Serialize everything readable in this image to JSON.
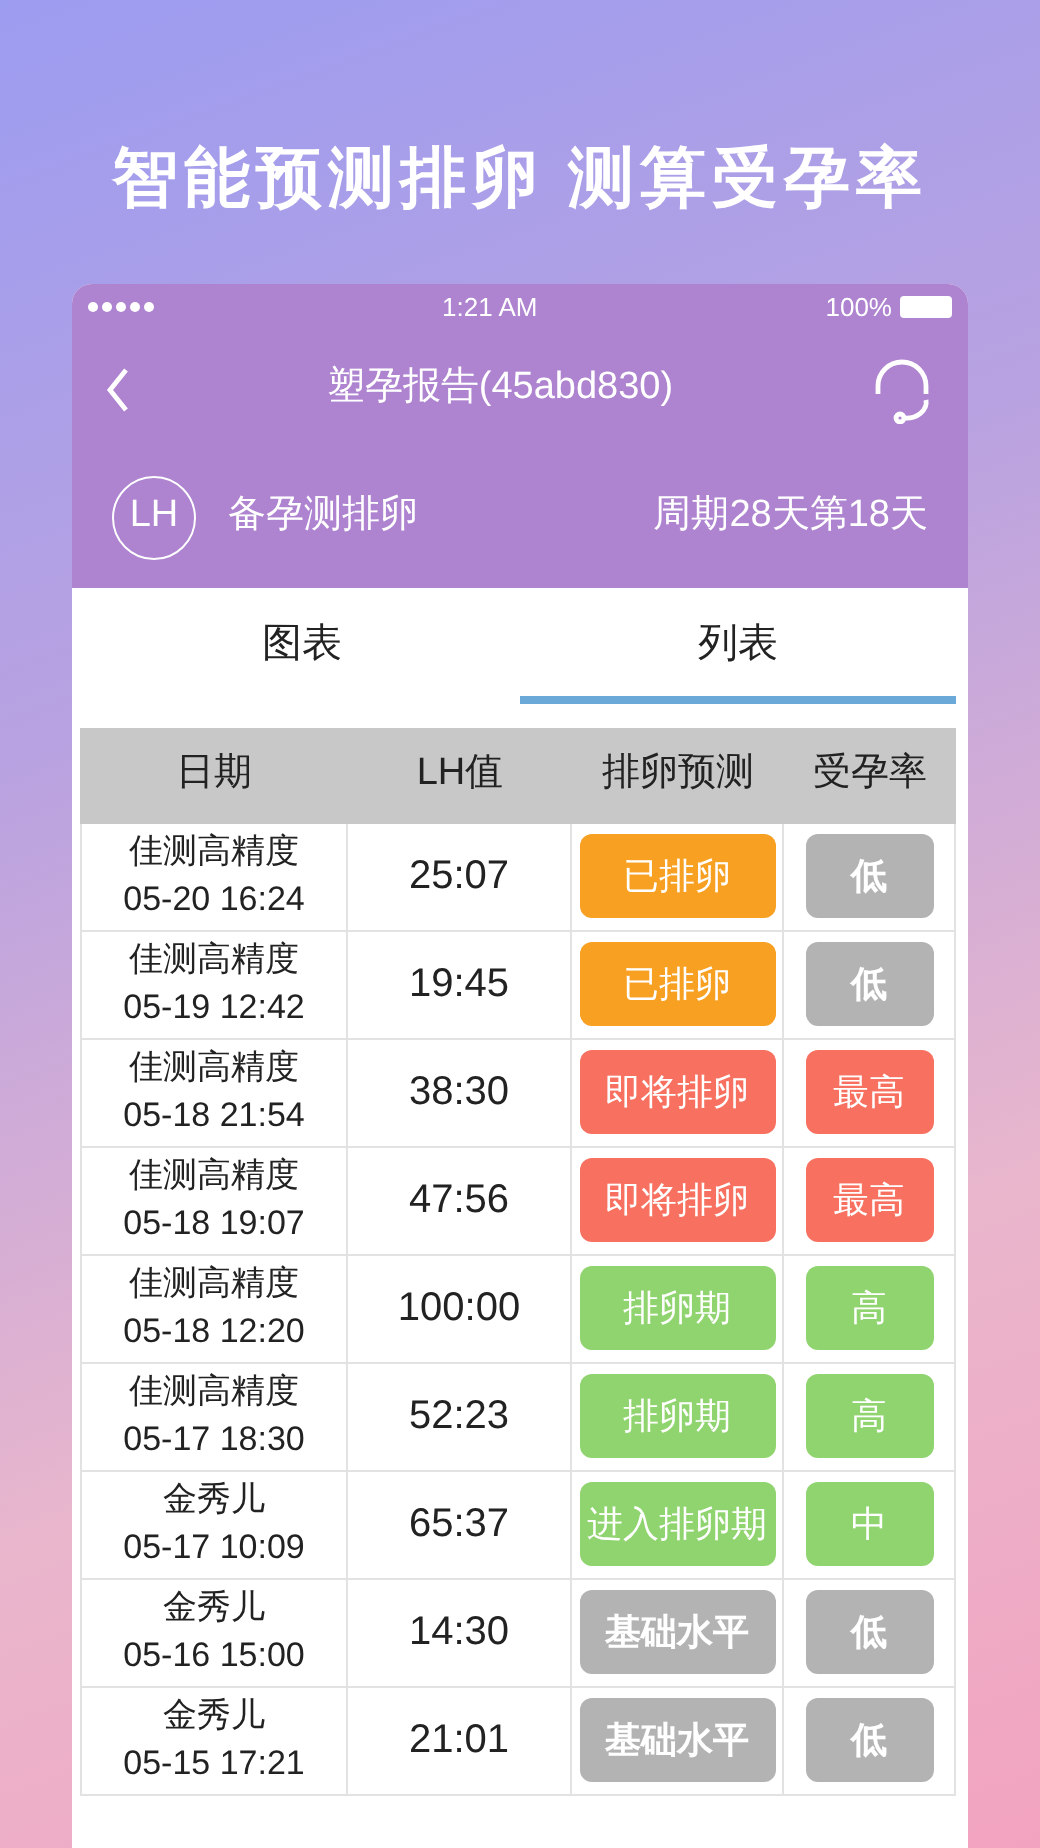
{
  "headline": "智能预测排卵 测算受孕率",
  "status_bar": {
    "time": "1:21 AM",
    "battery": "100%"
  },
  "nav": {
    "title": "塑孕报告(45abd830)"
  },
  "info": {
    "badge": "LH",
    "label": "备孕测排卵",
    "cycle": "周期28天第18天"
  },
  "tabs": [
    {
      "label": "图表",
      "selected": false
    },
    {
      "label": "列表",
      "selected": true
    }
  ],
  "table": {
    "columns": [
      "日期",
      "LH值",
      "排卵预测",
      "受孕率"
    ],
    "rows": [
      {
        "source": "佳测高精度",
        "date": "05-20 16:24",
        "lh": "25:07",
        "prediction": {
          "text": "已排卵",
          "color": "#f7a021"
        },
        "rate": {
          "text": "低",
          "color": "#b3b3b3"
        }
      },
      {
        "source": "佳测高精度",
        "date": "05-19 12:42",
        "lh": "19:45",
        "prediction": {
          "text": "已排卵",
          "color": "#f7a021"
        },
        "rate": {
          "text": "低",
          "color": "#b3b3b3"
        }
      },
      {
        "source": "佳测高精度",
        "date": "05-18 21:54",
        "lh": "38:30",
        "prediction": {
          "text": "即将排卵",
          "color": "#f87160"
        },
        "rate": {
          "text": "最高",
          "color": "#f87160"
        }
      },
      {
        "source": "佳测高精度",
        "date": "05-18 19:07",
        "lh": "47:56",
        "prediction": {
          "text": "即将排卵",
          "color": "#f87160"
        },
        "rate": {
          "text": "最高",
          "color": "#f87160"
        }
      },
      {
        "source": "佳测高精度",
        "date": "05-18 12:20",
        "lh": "100:00",
        "prediction": {
          "text": "排卵期",
          "color": "#8fd46f"
        },
        "rate": {
          "text": "高",
          "color": "#8fd46f"
        }
      },
      {
        "source": "佳测高精度",
        "date": "05-17 18:30",
        "lh": "52:23",
        "prediction": {
          "text": "排卵期",
          "color": "#8fd46f"
        },
        "rate": {
          "text": "高",
          "color": "#8fd46f"
        }
      },
      {
        "source": "金秀儿",
        "date": "05-17 10:09",
        "lh": "65:37",
        "prediction": {
          "text": "进入排卵期",
          "color": "#8fd46f"
        },
        "rate": {
          "text": "中",
          "color": "#8fd46f"
        }
      },
      {
        "source": "金秀儿",
        "date": "05-16 15:00",
        "lh": "14:30",
        "prediction": {
          "text": "基础水平",
          "color": "#b3b3b3"
        },
        "rate": {
          "text": "低",
          "color": "#b3b3b3"
        }
      },
      {
        "source": "金秀儿",
        "date": "05-15 17:21",
        "lh": "21:01",
        "prediction": {
          "text": "基础水平",
          "color": "#b3b3b3"
        },
        "rate": {
          "text": "低",
          "color": "#b3b3b3"
        }
      }
    ]
  }
}
